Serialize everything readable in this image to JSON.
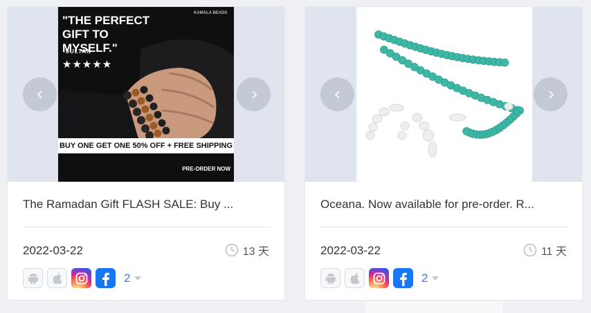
{
  "cards": [
    {
      "image": {
        "headline": "\"THE PERFECT GIFT TO MYSELF.\"",
        "attribution": "-SULTAN",
        "stars": "★★★★★",
        "brand": "KAMALA BEADS",
        "banner": "BUY ONE GET ONE 50% OFF + FREE SHIPPING",
        "cta": "PRE-ORDER NOW"
      },
      "title": "The Ramadan Gift FLASH SALE: Buy ...",
      "date": "2022-03-22",
      "duration": "13 天",
      "more_count": "2"
    },
    {
      "title": "Oceana. Now available for pre-order. R...",
      "date": "2022-03-22",
      "duration": "11 天",
      "more_count": "2"
    }
  ],
  "colors": {
    "accent": "#3a7ae8",
    "card_bg": "#ffffff",
    "media_bg": "#dfe4ee",
    "page_bg": "#eef0f4",
    "bead": "#3db8a6"
  },
  "icons": [
    "chevron-left-icon",
    "chevron-right-icon",
    "clock-icon",
    "android-icon",
    "apple-icon",
    "instagram-icon",
    "facebook-icon",
    "caret-down-icon"
  ]
}
